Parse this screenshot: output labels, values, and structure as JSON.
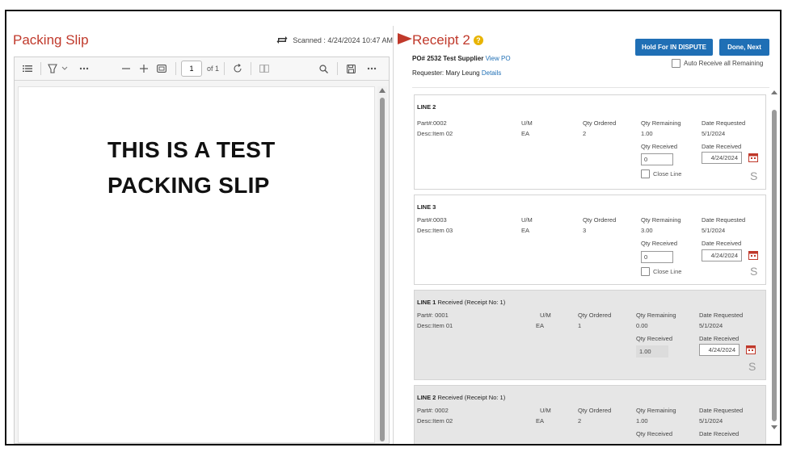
{
  "packing_slip": {
    "title": "Packing Slip",
    "scanned_text": "Scanned : 4/24/2024 10:47 AM",
    "viewer": {
      "page_value": "1",
      "page_of": "of 1",
      "content_line1": "THIS IS A TEST",
      "content_line2": "PACKING SLIP"
    }
  },
  "receipt": {
    "title": "Receipt 2",
    "help_icon": "?",
    "po_text": "PO# 2532 Test Supplier",
    "view_po_link": "View PO",
    "requester_text": "Requester: Mary Leung",
    "details_link": "Details",
    "hold_button": "Hold For IN DISPUTE",
    "done_button": "Done, Next",
    "auto_receive_label": "Auto Receive all Remaining"
  },
  "labels": {
    "um": "U/M",
    "qty_ordered": "Qty Ordered",
    "qty_remaining": "Qty Remaining",
    "date_requested": "Date Requested",
    "qty_received": "Qty Received",
    "date_received": "Date Received",
    "close_line": "Close Line",
    "s_glyph": "S"
  },
  "lines": [
    {
      "title": "LINE 2",
      "status": "",
      "part": "Part#:0002",
      "desc": "Desc:Item 02",
      "um": "EA",
      "qty_ordered": "2",
      "qty_remaining": "1.00",
      "date_requested": "5/1/2024",
      "qty_received": "0",
      "date_received": "4/24/2024"
    },
    {
      "title": "LINE 3",
      "status": "",
      "part": "Part#:0003",
      "desc": "Desc:Item 03",
      "um": "EA",
      "qty_ordered": "3",
      "qty_remaining": "3.00",
      "date_requested": "5/1/2024",
      "qty_received": "0",
      "date_received": "4/24/2024"
    },
    {
      "title": "LINE 1",
      "status": "Received (Receipt No: 1)",
      "part": "Part#: 0001",
      "desc": "Desc:Item 01",
      "um": "EA",
      "qty_ordered": "1",
      "qty_remaining": "0.00",
      "date_requested": "5/1/2024",
      "qty_received": "1.00",
      "date_received": "4/24/2024"
    },
    {
      "title": "LINE 2",
      "status": "Received (Receipt No: 1)",
      "part": "Part#: 0002",
      "desc": "Desc:Item 02",
      "um": "EA",
      "qty_ordered": "2",
      "qty_remaining": "1.00",
      "date_requested": "5/1/2024"
    }
  ],
  "colors": {
    "title_red": "#c0392b",
    "button_blue": "#1f6fb5",
    "help_yellow": "#e8b400",
    "received_bg": "#e6e6e6"
  }
}
